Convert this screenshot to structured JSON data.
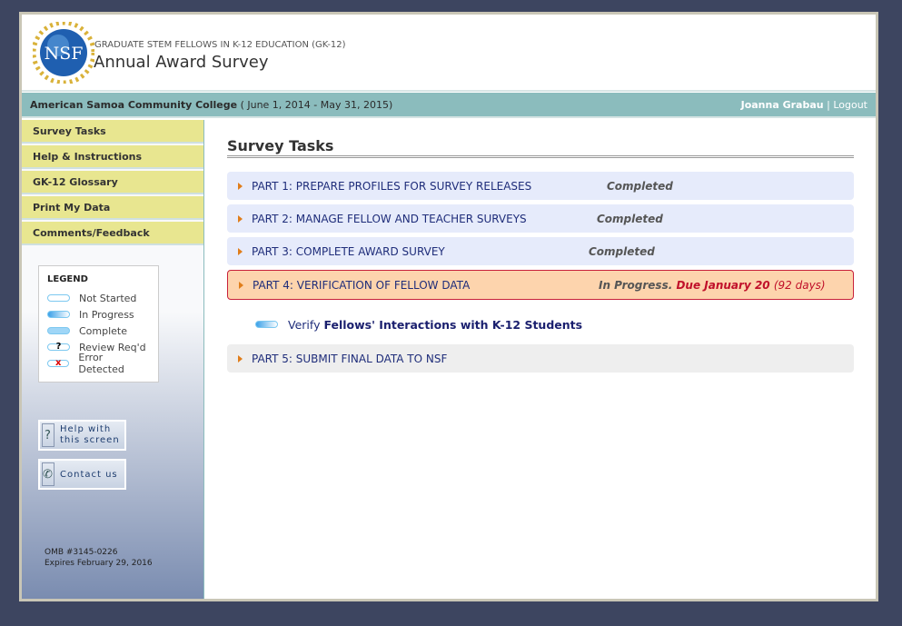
{
  "header": {
    "logo_text": "NSF",
    "subtitle": "GRADUATE STEM FELLOWS IN K-12 EDUCATION (GK-12)",
    "title": "Annual Award Survey"
  },
  "bar": {
    "institution": "American Samoa Community College",
    "period": "( June 1, 2014 - May 31, 2015)",
    "user": "Joanna Grabau",
    "sep": "|",
    "logout": "Logout"
  },
  "menu": [
    "Survey Tasks",
    "Help & Instructions",
    "GK-12 Glossary",
    "Print My Data",
    "Comments/Feedback"
  ],
  "legend": {
    "title": "LEGEND",
    "items": [
      "Not Started",
      "In Progress",
      "Complete",
      "Review Req'd",
      "Error Detected"
    ],
    "review_mark": "?",
    "error_mark": "x"
  },
  "buttons": {
    "help": "Help with this screen",
    "contact": "Contact us",
    "help_icon": "?",
    "contact_icon": "✆"
  },
  "omb": {
    "line1": "OMB #3145-0226",
    "line2": "Expires February 29, 2016"
  },
  "main": {
    "title": "Survey Tasks",
    "parts": [
      {
        "label": "PART 1: PREPARE PROFILES FOR SURVEY RELEASES",
        "status": "Completed"
      },
      {
        "label": "PART 2: MANAGE FELLOW AND TEACHER SURVEYS",
        "status": "Completed"
      },
      {
        "label": "PART 3: COMPLETE AWARD SURVEY",
        "status": "Completed"
      },
      {
        "label": "PART 4: VERIFICATION OF FELLOW DATA",
        "status": "In Progress.",
        "due": "Due January 20",
        "days": "(92 days)"
      },
      {
        "label": "PART 5: SUBMIT FINAL DATA TO NSF"
      }
    ],
    "subtask": {
      "verb": "Verify",
      "link": "Fellows' Interactions with K-12 Students"
    }
  },
  "colors": {
    "accent": "#8bbcbd",
    "menu": "#e8e690",
    "current": "#fdd4ad",
    "due": "#c0102a"
  }
}
